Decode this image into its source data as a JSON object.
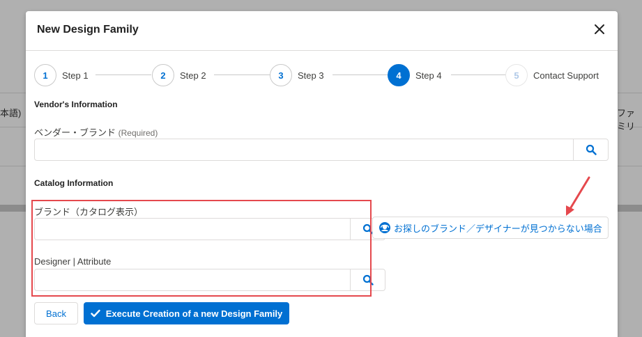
{
  "background": {
    "left_text": "本語)",
    "right_text": "ファミリ"
  },
  "modal": {
    "title": "New Design Family",
    "close_icon": "close-icon"
  },
  "steps": [
    {
      "number": "1",
      "label": "Step 1",
      "state": "default"
    },
    {
      "number": "2",
      "label": "Step 2",
      "state": "default"
    },
    {
      "number": "3",
      "label": "Step 3",
      "state": "default"
    },
    {
      "number": "4",
      "label": "Step 4",
      "state": "active"
    },
    {
      "number": "5",
      "label": "Contact Support",
      "state": "disabled"
    }
  ],
  "vendor_section": {
    "title": "Vendor's Information",
    "brand_label": "ベンダー・ブランド",
    "brand_required": "(Required)",
    "brand_value": ""
  },
  "catalog_section": {
    "title": "Catalog Information",
    "brand_label": "ブランド（カタログ表示）",
    "brand_value": "",
    "designer_label": "Designer | Attribute",
    "designer_value": "",
    "help_button": "お探しのブランド／デザイナーが見つからない場合"
  },
  "footer": {
    "back_label": "Back",
    "execute_label": "Execute Creation of a new Design Family"
  },
  "colors": {
    "brand": "#0070d2",
    "highlight": "#e5484d",
    "annotation_arrow": "#e5484d"
  }
}
